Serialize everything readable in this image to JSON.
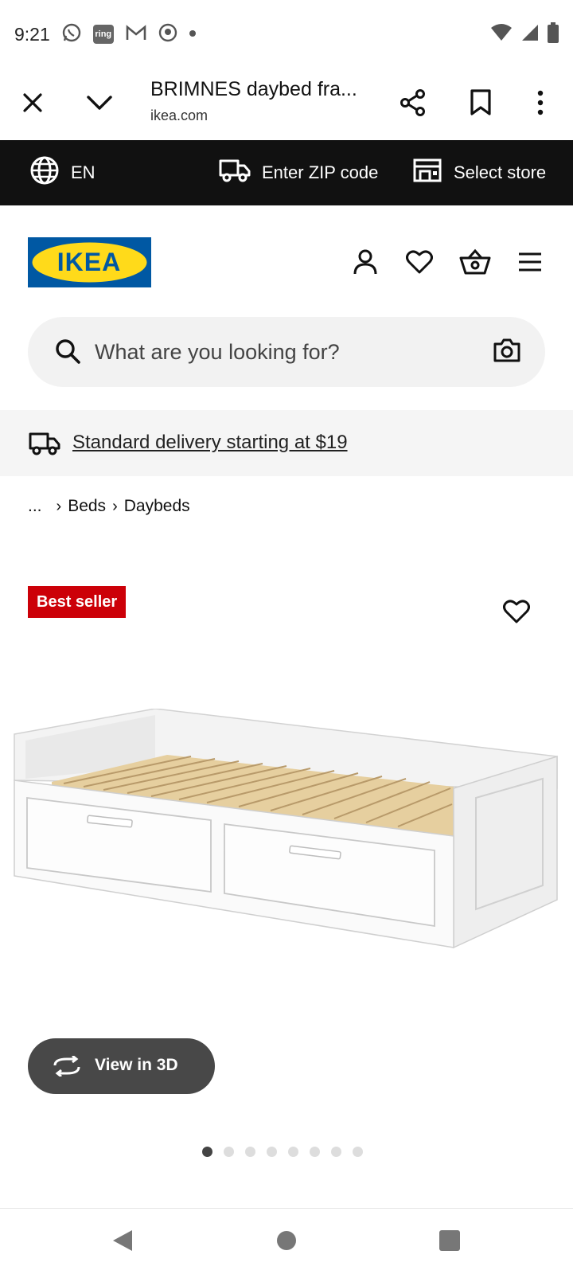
{
  "status_bar": {
    "time": "9:21",
    "icons": [
      "whatsapp-icon",
      "ring-icon",
      "gmail-icon",
      "app-icon",
      "dot-icon"
    ],
    "ring_label": "ring",
    "right_icons": [
      "wifi-icon",
      "signal-icon",
      "battery-icon"
    ]
  },
  "toolbar": {
    "title": "BRIMNES daybed fra...",
    "url": "ikea.com",
    "icons": [
      "close-icon",
      "chevron-down-icon",
      "share-icon",
      "bookmark-icon",
      "more-vert-icon"
    ]
  },
  "topbar": {
    "language": "EN",
    "zip_label": "Enter ZIP code",
    "store_label": "Select store"
  },
  "header": {
    "logo_text": "IKEA",
    "colors": {
      "logo_blue": "#0058A3",
      "logo_yellow": "#FFDA1A"
    },
    "icons": [
      "account-icon",
      "heart-icon",
      "basket-icon",
      "menu-icon"
    ]
  },
  "search": {
    "placeholder": "What are you looking for?"
  },
  "delivery": {
    "text": "Standard delivery starting at $19"
  },
  "breadcrumb": {
    "ellipsis": "...",
    "items": [
      "Beds",
      "Daybeds"
    ]
  },
  "product": {
    "badge": "Best seller",
    "badge_color": "#CC0008",
    "view3d_label": "View in 3D",
    "carousel": {
      "count": 8,
      "active_index": 0
    }
  },
  "navbar": {
    "icons": [
      "back-icon",
      "home-icon",
      "recents-icon"
    ]
  }
}
